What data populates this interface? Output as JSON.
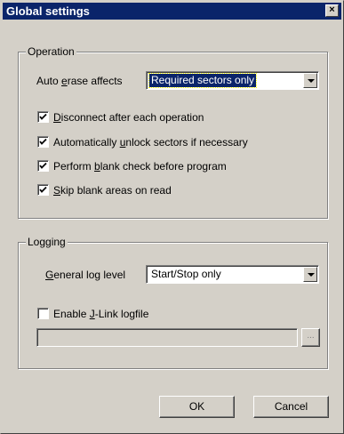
{
  "window": {
    "title": "Global settings",
    "close_glyph": "×"
  },
  "operation": {
    "group_label": "Operation",
    "auto_erase": {
      "label_pre": "Auto ",
      "label_key": "e",
      "label_post": "rase affects",
      "selected": "Required sectors only"
    },
    "options": [
      {
        "pre": "",
        "key": "D",
        "post": "isconnect after each operation",
        "checked": true
      },
      {
        "pre": "Automatically ",
        "key": "u",
        "post": "nlock sectors if necessary",
        "checked": true
      },
      {
        "pre": "Perform ",
        "key": "b",
        "post": "lank check before program",
        "checked": true
      },
      {
        "pre": "",
        "key": "S",
        "post": "kip blank areas on read",
        "checked": true
      }
    ]
  },
  "logging": {
    "group_label": "Logging",
    "log_level": {
      "label_pre": "",
      "label_key": "G",
      "label_post": "eneral log level",
      "selected": "Start/Stop only"
    },
    "enable_logfile": {
      "pre": "Enable ",
      "key": "J",
      "post": "-Link logfile",
      "checked": false
    },
    "logfile_path": "",
    "browse_label": "..."
  },
  "buttons": {
    "ok": "OK",
    "cancel": "Cancel"
  },
  "icons": {
    "close": "close-icon",
    "dropdown": "chevron-down-icon",
    "check": "check-icon"
  }
}
